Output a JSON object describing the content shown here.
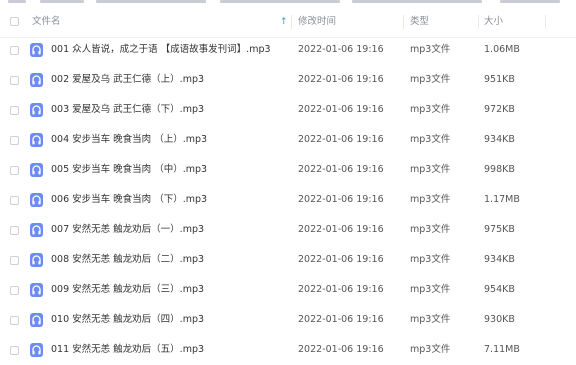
{
  "header": {
    "name_label": "文件名",
    "time_label": "修改时间",
    "type_label": "类型",
    "size_label": "大小"
  },
  "files": [
    {
      "name": "001 众人皆说，成之于语 【成语故事发刊词】.mp3",
      "time": "2022-01-06 19:16",
      "type": "mp3文件",
      "size": "1.06MB"
    },
    {
      "name": "002 爱屋及乌 武王仁德（上）.mp3",
      "time": "2022-01-06 19:16",
      "type": "mp3文件",
      "size": "951KB"
    },
    {
      "name": "003 爱屋及乌 武王仁德（下）.mp3",
      "time": "2022-01-06 19:16",
      "type": "mp3文件",
      "size": "972KB"
    },
    {
      "name": "004 安步当车 晚食当肉 （上）.mp3",
      "time": "2022-01-06 19:16",
      "type": "mp3文件",
      "size": "934KB"
    },
    {
      "name": "005 安步当车 晚食当肉 （中）.mp3",
      "time": "2022-01-06 19:16",
      "type": "mp3文件",
      "size": "998KB"
    },
    {
      "name": "006 安步当车 晚食当肉 （下）.mp3",
      "time": "2022-01-06 19:16",
      "type": "mp3文件",
      "size": "1.17MB"
    },
    {
      "name": "007 安然无恙 触龙劝后（一）.mp3",
      "time": "2022-01-06 19:16",
      "type": "mp3文件",
      "size": "975KB"
    },
    {
      "name": "008 安然无恙 触龙劝后（二）.mp3",
      "time": "2022-01-06 19:16",
      "type": "mp3文件",
      "size": "934KB"
    },
    {
      "name": "009 安然无恙 触龙劝后（三）.mp3",
      "time": "2022-01-06 19:16",
      "type": "mp3文件",
      "size": "954KB"
    },
    {
      "name": "010 安然无恙 触龙劝后（四）.mp3",
      "time": "2022-01-06 19:16",
      "type": "mp3文件",
      "size": "930KB"
    },
    {
      "name": "011 安然无恙 触龙劝后（五）.mp3",
      "time": "2022-01-06 19:16",
      "type": "mp3文件",
      "size": "7.11MB"
    }
  ],
  "colors": {
    "accent": "#3b8cff",
    "file_icon": "#6c8cf5"
  },
  "icons": {
    "file_icon": "audio-file-icon",
    "sort_icon": "sort-up-arrow-icon"
  }
}
